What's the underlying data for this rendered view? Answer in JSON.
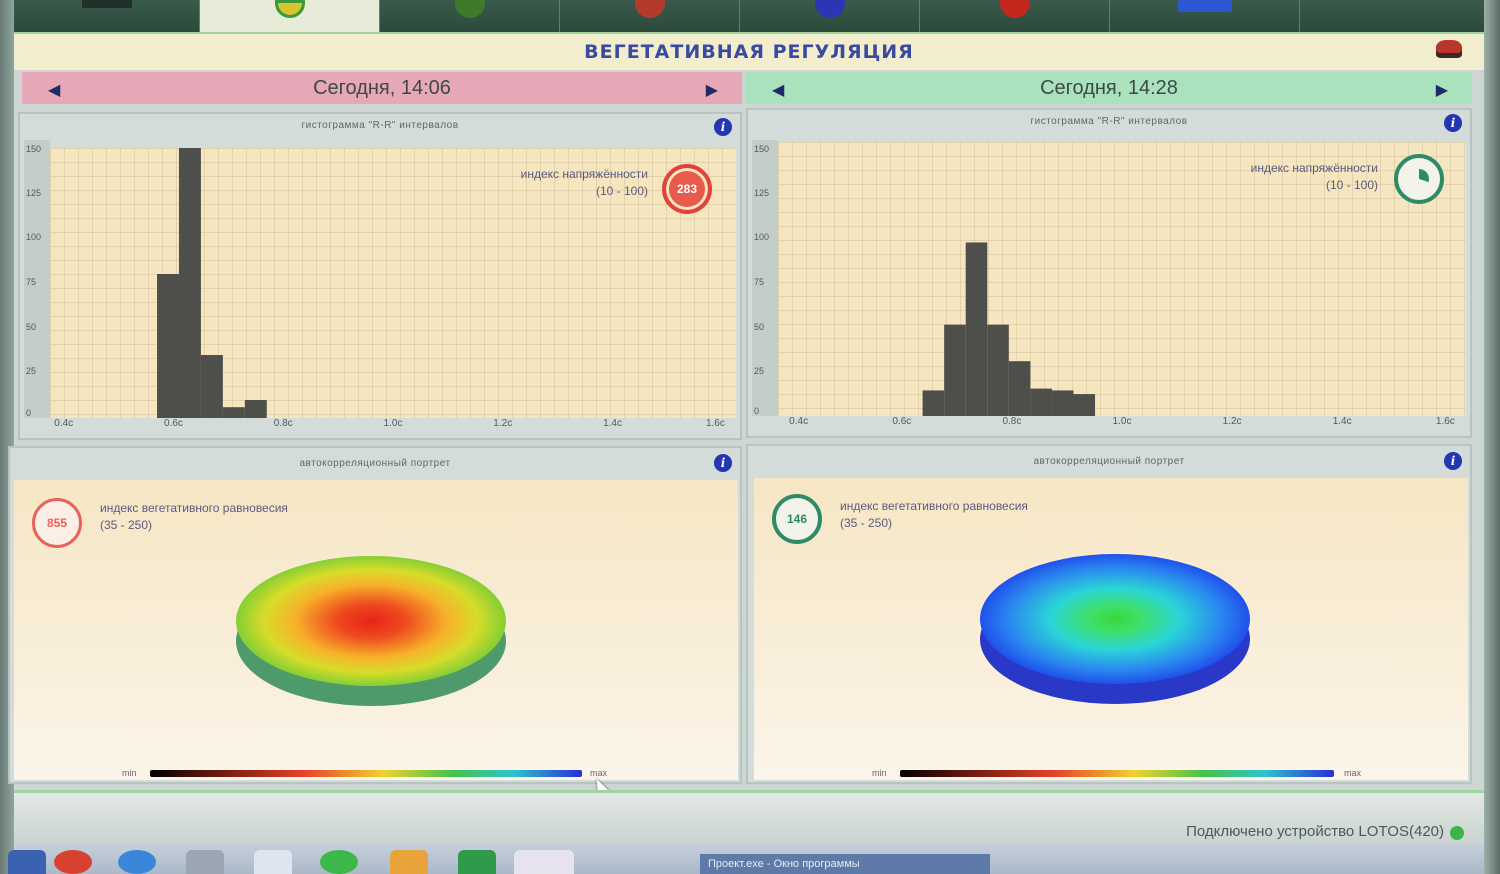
{
  "header": {
    "title": "ВЕГЕТАТИВНАЯ РЕГУЛЯЦИЯ"
  },
  "toolbar": {
    "tabs": [
      {
        "icon": "heart-rate-icon",
        "color": "#d8c431"
      },
      {
        "icon": "group-icon",
        "color": "#3f7a2a"
      },
      {
        "icon": "chart-icon",
        "color": "#b43b2c"
      },
      {
        "icon": "globe-icon",
        "color": "#2a36b4"
      },
      {
        "icon": "stop-icon",
        "color": "#c3281e"
      },
      {
        "icon": "monitor-icon",
        "color": "#2d56d4"
      }
    ]
  },
  "left": {
    "date": "Сегодня, 14:06",
    "histogram": {
      "title": "гистограмма \"R-R\" интервалов",
      "index_label": "индекс напряжённости",
      "index_range": "(10 - 100)",
      "badge_value": "283"
    },
    "portrait": {
      "title": "автокорреляционный портрет",
      "index_label": "индекс вегетативного равновесия",
      "index_range": "(35 - 250)",
      "badge_value": "855"
    }
  },
  "right": {
    "date": "Сегодня, 14:28",
    "histogram": {
      "title": "гистограмма \"R-R\" интервалов",
      "index_label": "индекс напряжённости",
      "index_range": "(10 - 100)",
      "badge_value": ""
    },
    "portrait": {
      "title": "автокорреляционный портрет",
      "index_label": "индекс вегетативного равновесия",
      "index_range": "(35 - 250)",
      "badge_value": "146"
    }
  },
  "colorbar": {
    "min_label": "min",
    "max_label": "max"
  },
  "status": {
    "connection": "Подключено устройство LOTOS(420)"
  },
  "taskbar": {
    "window_title": "Проект.exe - Окно программы"
  },
  "chart_data": [
    {
      "type": "bar",
      "title": "гистограмма \"R-R\" интервалов",
      "x_ticks": [
        "0.4c",
        "0.6c",
        "0.8c",
        "1.0c",
        "1.2c",
        "1.4c",
        "1.6c"
      ],
      "y_ticks": [
        0,
        25,
        50,
        75,
        100,
        125,
        150
      ],
      "ylim": [
        0,
        150
      ],
      "xlim": [
        0.4,
        1.6
      ],
      "bins": [
        {
          "x0": 0.57,
          "x1": 0.61,
          "value": 80
        },
        {
          "x0": 0.61,
          "x1": 0.65,
          "value": 150
        },
        {
          "x0": 0.65,
          "x1": 0.69,
          "value": 35
        },
        {
          "x0": 0.69,
          "x1": 0.73,
          "value": 6
        },
        {
          "x0": 0.73,
          "x1": 0.77,
          "value": 10
        }
      ]
    },
    {
      "type": "bar",
      "title": "гистограмма \"R-R\" интервалов",
      "x_ticks": [
        "0.4c",
        "0.6c",
        "0.8c",
        "1.0c",
        "1.2c",
        "1.4c",
        "1.6c"
      ],
      "y_ticks": [
        0,
        25,
        50,
        75,
        100,
        125,
        150
      ],
      "ylim": [
        0,
        150
      ],
      "xlim": [
        0.4,
        1.6
      ],
      "bins": [
        {
          "x0": 0.63,
          "x1": 0.67,
          "value": 14
        },
        {
          "x0": 0.67,
          "x1": 0.71,
          "value": 50
        },
        {
          "x0": 0.71,
          "x1": 0.75,
          "value": 95
        },
        {
          "x0": 0.75,
          "x1": 0.79,
          "value": 50
        },
        {
          "x0": 0.79,
          "x1": 0.83,
          "value": 30
        },
        {
          "x0": 0.83,
          "x1": 0.87,
          "value": 15
        },
        {
          "x0": 0.87,
          "x1": 0.91,
          "value": 14
        },
        {
          "x0": 0.91,
          "x1": 0.95,
          "value": 12
        }
      ]
    }
  ]
}
